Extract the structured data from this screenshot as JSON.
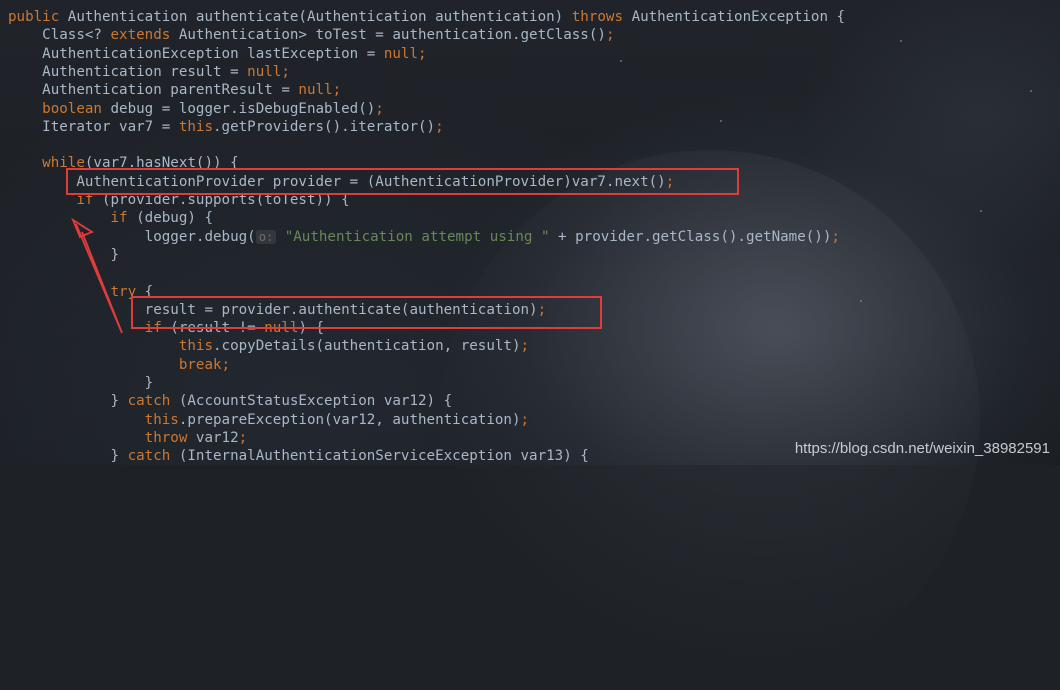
{
  "code_lines": [
    [
      {
        "t": "public ",
        "c": "kw"
      },
      {
        "t": "Authentication authenticate(Authentication authentication) ",
        "c": ""
      },
      {
        "t": "throws ",
        "c": "kw"
      },
      {
        "t": "AuthenticationException {",
        "c": ""
      }
    ],
    [
      {
        "t": "    Class<? ",
        "c": ""
      },
      {
        "t": "extends ",
        "c": "kw"
      },
      {
        "t": "Authentication> toTest = authentication.getClass()",
        "c": ""
      },
      {
        "t": ";",
        "c": "kw"
      }
    ],
    [
      {
        "t": "    AuthenticationException lastException = ",
        "c": ""
      },
      {
        "t": "null;",
        "c": "kw"
      }
    ],
    [
      {
        "t": "    Authentication result = ",
        "c": ""
      },
      {
        "t": "null;",
        "c": "kw"
      }
    ],
    [
      {
        "t": "    Authentication parentResult = ",
        "c": ""
      },
      {
        "t": "null;",
        "c": "kw"
      }
    ],
    [
      {
        "t": "    boolean ",
        "c": "kw"
      },
      {
        "t": "debug = logger.isDebugEnabled()",
        "c": ""
      },
      {
        "t": ";",
        "c": "kw"
      }
    ],
    [
      {
        "t": "    Iterator var7 = ",
        "c": ""
      },
      {
        "t": "this",
        "c": "kw"
      },
      {
        "t": ".getProviders().iterator()",
        "c": ""
      },
      {
        "t": ";",
        "c": "kw"
      }
    ],
    [],
    [
      {
        "t": "    while",
        "c": "kw"
      },
      {
        "t": "(var7.hasNext()) {",
        "c": ""
      }
    ],
    [
      {
        "t": "        AuthenticationProvider provider = (AuthenticationProvider)var7.next()",
        "c": ""
      },
      {
        "t": ";",
        "c": "kw"
      }
    ],
    [
      {
        "t": "        if ",
        "c": "kw"
      },
      {
        "t": "(provider.supports(toTest)) {",
        "c": ""
      }
    ],
    [
      {
        "t": "            if ",
        "c": "kw"
      },
      {
        "t": "(debug) {",
        "c": ""
      }
    ],
    [
      {
        "t": "                logger.debug(",
        "c": ""
      },
      {
        "t": "o:",
        "c": "hint"
      },
      {
        "t": " ",
        "c": ""
      },
      {
        "t": "\"Authentication attempt using \"",
        "c": "str"
      },
      {
        "t": " + provider.getClass().getName())",
        "c": ""
      },
      {
        "t": ";",
        "c": "kw"
      }
    ],
    [
      {
        "t": "            }",
        "c": ""
      }
    ],
    [],
    [
      {
        "t": "            try ",
        "c": "kw"
      },
      {
        "t": "{",
        "c": ""
      }
    ],
    [
      {
        "t": "                result = provider.authenticate(authentication)",
        "c": ""
      },
      {
        "t": ";",
        "c": "kw"
      }
    ],
    [
      {
        "t": "                if ",
        "c": "kw"
      },
      {
        "t": "(result != ",
        "c": ""
      },
      {
        "t": "null",
        "c": "kw"
      },
      {
        "t": ") {",
        "c": ""
      }
    ],
    [
      {
        "t": "                    this",
        "c": "kw"
      },
      {
        "t": ".copyDetails(authentication, result)",
        "c": ""
      },
      {
        "t": ";",
        "c": "kw"
      }
    ],
    [
      {
        "t": "                    break;",
        "c": "kw"
      }
    ],
    [
      {
        "t": "                }",
        "c": ""
      }
    ],
    [
      {
        "t": "            } ",
        "c": ""
      },
      {
        "t": "catch ",
        "c": "kw"
      },
      {
        "t": "(AccountStatusException var12) {",
        "c": ""
      }
    ],
    [
      {
        "t": "                this",
        "c": "kw"
      },
      {
        "t": ".prepareException(var12, authentication)",
        "c": ""
      },
      {
        "t": ";",
        "c": "kw"
      }
    ],
    [
      {
        "t": "                throw ",
        "c": "kw"
      },
      {
        "t": "var12",
        "c": ""
      },
      {
        "t": ";",
        "c": "kw"
      }
    ],
    [
      {
        "t": "            } ",
        "c": ""
      },
      {
        "t": "catch ",
        "c": "kw"
      },
      {
        "t": "(InternalAuthenticationServiceException var13) {",
        "c": ""
      }
    ]
  ],
  "watermark": "https://blog.csdn.net/weixin_38982591",
  "colors": {
    "keyword": "#cc7832",
    "plain": "#a9b7c6",
    "string": "#6a8759",
    "annotation_red": "#e03c3c",
    "background": "#1e2227"
  },
  "icons": {
    "annotation_arrow": "red-arrow-icon"
  }
}
